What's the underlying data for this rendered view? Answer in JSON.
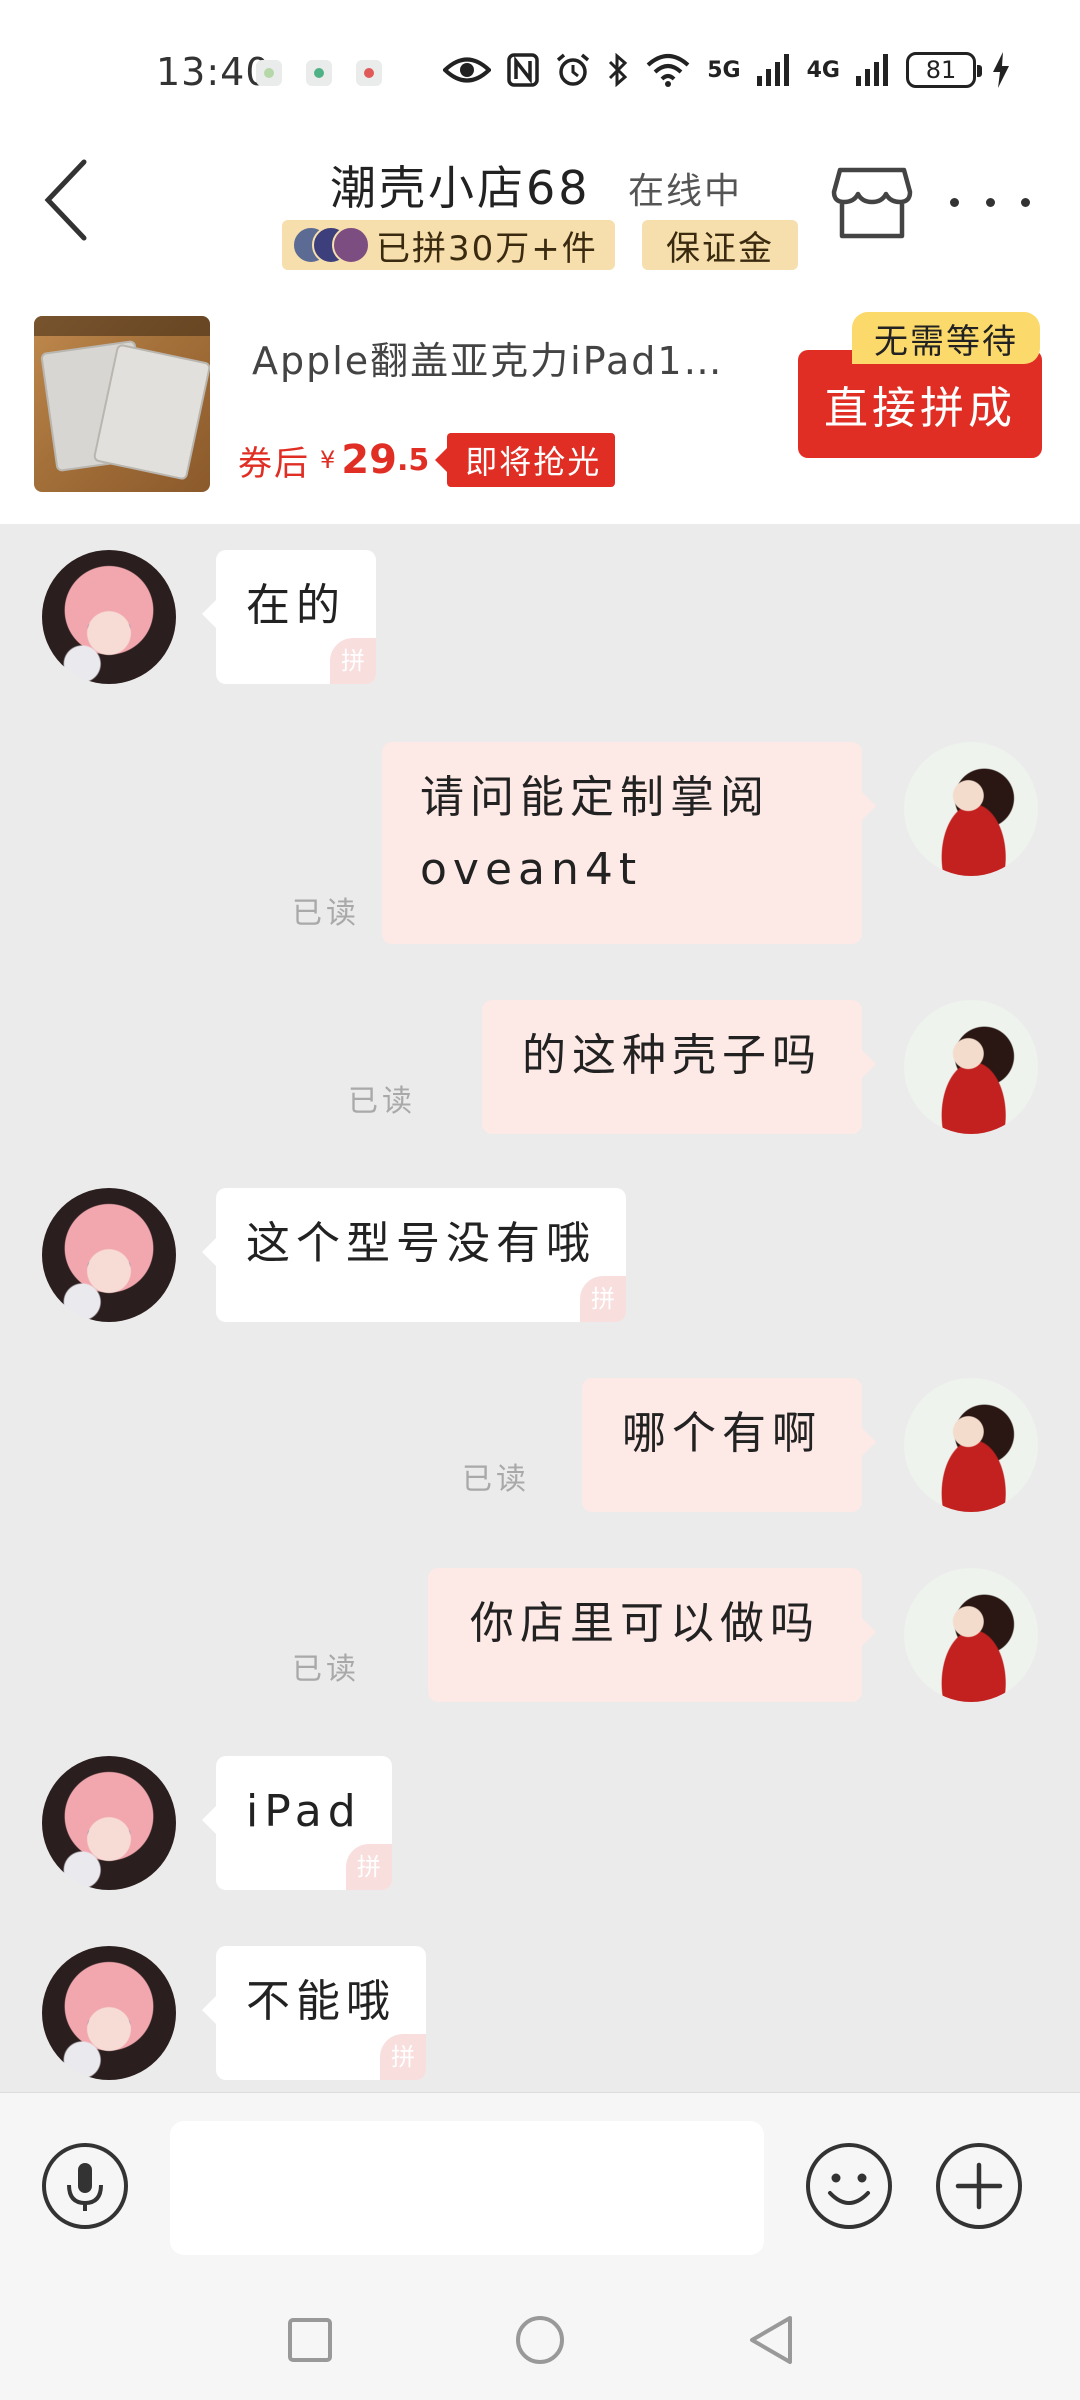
{
  "status_bar": {
    "time": "13:40",
    "network_5g": "5G",
    "network_4g": "4G",
    "battery": "81"
  },
  "header": {
    "shop_name": "潮壳小店68",
    "online_status": "在线中",
    "sales_badge": "已拼30万+件",
    "deposit_badge": "保证金"
  },
  "product": {
    "title": "Apple翻盖亚克力iPad1…",
    "coupon_label": "券后",
    "currency": "¥",
    "price_integer": "29",
    "price_decimal": ".5",
    "flash_badge": "即将抢光",
    "buy_button": "直接拼成",
    "no_wait_tag": "无需等待"
  },
  "messages": [
    {
      "side": "left",
      "text": "在的"
    },
    {
      "side": "right",
      "lines": [
        "请问能定制掌阅",
        "ovean4t"
      ],
      "read": "已读"
    },
    {
      "side": "right",
      "text": "的这种壳子吗",
      "read": "已读"
    },
    {
      "side": "left",
      "text": "这个型号没有哦"
    },
    {
      "side": "right",
      "text": "哪个有啊",
      "read": "已读"
    },
    {
      "side": "right",
      "text": "你店里可以做吗",
      "read": "已读"
    },
    {
      "side": "left",
      "text": "iPad"
    },
    {
      "side": "left",
      "text": "不能哦"
    }
  ],
  "input": {
    "value": "",
    "placeholder": ""
  },
  "icons": {
    "back": "chevron-left-icon",
    "store": "store-icon",
    "more": "more-dots-icon",
    "voice": "microphone-icon",
    "emoji": "emoji-icon",
    "plus": "plus-icon"
  },
  "colors": {
    "accent_red": "#e02e24",
    "badge_gold": "#f6dfac",
    "no_wait_yellow": "#fcd96b",
    "chat_bg": "#ebebeb",
    "user_bubble": "#fde9e6"
  }
}
